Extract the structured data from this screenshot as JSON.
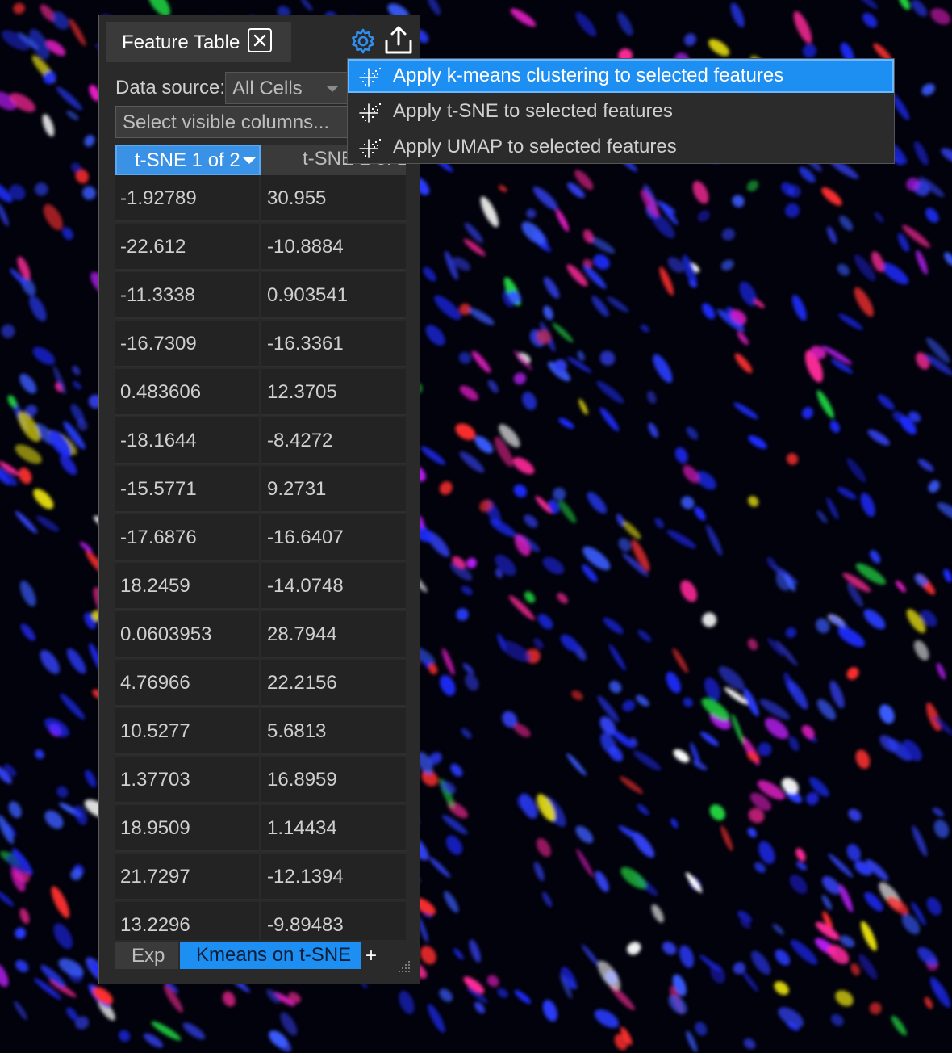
{
  "panel": {
    "tab_title": "Feature Table",
    "data_source_label": "Data source:",
    "data_source_value": "All Cells",
    "column_select_placeholder": "Select visible columns..."
  },
  "table": {
    "headers": [
      "t-SNE 1 of 2",
      "t-SNE 2 of 2"
    ],
    "rows": [
      [
        "-1.92789",
        "30.955"
      ],
      [
        "-22.612",
        "-10.8884"
      ],
      [
        "-11.3338",
        "0.903541"
      ],
      [
        "-16.7309",
        "-16.3361"
      ],
      [
        "0.483606",
        "12.3705"
      ],
      [
        "-18.1644",
        "-8.4272"
      ],
      [
        "-15.5771",
        "9.2731"
      ],
      [
        "-17.6876",
        "-16.6407"
      ],
      [
        "18.2459",
        "-14.0748"
      ],
      [
        "0.0603953",
        "28.7944"
      ],
      [
        "4.76966",
        "22.2156"
      ],
      [
        "10.5277",
        "5.6813"
      ],
      [
        "1.37703",
        "16.8959"
      ],
      [
        "18.9509",
        "1.14434"
      ],
      [
        "21.7297",
        "-12.1394"
      ],
      [
        "13.2296",
        "-9.89483"
      ]
    ]
  },
  "bottom_tabs": {
    "tab1": "Exp",
    "tab2": "Kmeans on t-SNE",
    "add": "+"
  },
  "menu": {
    "items": [
      {
        "label": "Apply k-means clustering to selected features",
        "icon": "scatter-sparkle-icon",
        "selected": true
      },
      {
        "label": "Apply t-SNE to selected features",
        "icon": "scatter-sparkle-icon"
      },
      {
        "label": "Apply UMAP to selected features",
        "icon": "scatter-sparkle-icon"
      }
    ]
  },
  "colors": {
    "accent": "#1e8ff2",
    "header_selected": "#3a92e6",
    "panel": "#2a2a2a",
    "cell": "#232323"
  }
}
